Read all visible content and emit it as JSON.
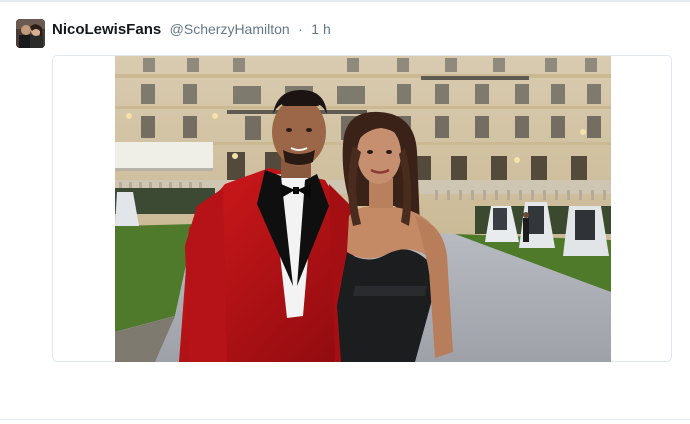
{
  "tweet": {
    "display_name": "NicoLewisFans",
    "handle": "@ScherzyHamilton",
    "separator": "·",
    "time": "1 h",
    "avatar_icon": "user-avatar"
  },
  "colors": {
    "name": "#14171a",
    "meta": "#657786",
    "border": "#e1e8ed"
  }
}
